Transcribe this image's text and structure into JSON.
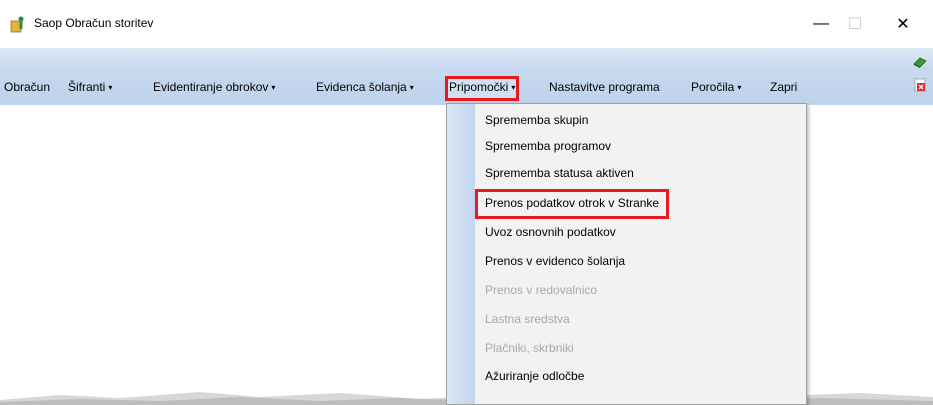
{
  "window": {
    "title": "Saop Obračun storitev",
    "minimize_glyph": "—",
    "maximize_glyph": "☐",
    "close_glyph": "✕"
  },
  "menubar": {
    "items": [
      {
        "label": "Obračun",
        "has_arrow": false,
        "highlighted": false
      },
      {
        "label": "Šifranti",
        "has_arrow": true,
        "highlighted": false
      },
      {
        "label": "Evidentiranje obrokov",
        "has_arrow": true,
        "highlighted": false
      },
      {
        "label": "Evidenca šolanja",
        "has_arrow": true,
        "highlighted": false
      },
      {
        "label": "Pripomočki",
        "has_arrow": true,
        "highlighted": true
      },
      {
        "label": "Nastavitve programa",
        "has_arrow": false,
        "highlighted": false
      },
      {
        "label": "Poročila",
        "has_arrow": true,
        "highlighted": false
      },
      {
        "label": "Zapri",
        "has_arrow": false,
        "highlighted": false
      }
    ],
    "arrow_glyph": "▾"
  },
  "dropdown": {
    "items": [
      {
        "label": "Sprememba skupin",
        "enabled": true,
        "highlighted": false
      },
      {
        "label": "Sprememba programov",
        "enabled": true,
        "highlighted": false
      },
      {
        "label": "Sprememba statusa aktiven",
        "enabled": true,
        "highlighted": false
      },
      {
        "label": "Prenos podatkov otrok v Stranke",
        "enabled": true,
        "highlighted": true
      },
      {
        "label": "Uvoz osnovnih podatkov",
        "enabled": true,
        "highlighted": false
      },
      {
        "label": "Prenos v evidenco šolanja",
        "enabled": true,
        "highlighted": false
      },
      {
        "label": "Prenos v redovalnico",
        "enabled": false,
        "highlighted": false
      },
      {
        "label": "Lastna sredstva",
        "enabled": false,
        "highlighted": false
      },
      {
        "label": "Plačniki, skrbniki",
        "enabled": false,
        "highlighted": false
      },
      {
        "label": "Ažuriranje odločbe",
        "enabled": true,
        "highlighted": false
      }
    ]
  },
  "colors": {
    "highlight_border": "#e51b1b",
    "menubar_bg": "#c8d9ef",
    "disabled_text": "#a9a9a9"
  },
  "icons": {
    "app": "folder-figure-icon",
    "toolbar_top": "green-book-icon",
    "toolbar_bottom": "close-document-icon"
  }
}
